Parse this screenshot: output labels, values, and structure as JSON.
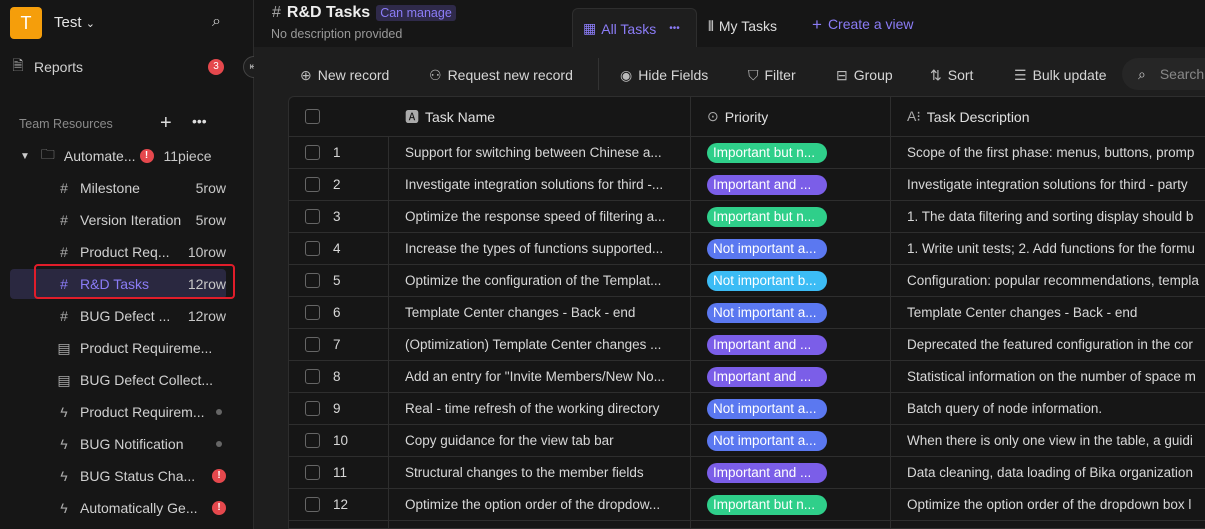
{
  "workspace": {
    "initial": "T",
    "name": "Test"
  },
  "sidebar": {
    "reports": {
      "label": "Reports",
      "badge": "3"
    },
    "section": "Team Resources",
    "folder": {
      "label": "Automate...",
      "count": "11piece"
    },
    "items": [
      {
        "icon": "table-icon",
        "label": "Milestone",
        "count": "5row"
      },
      {
        "icon": "table-icon",
        "label": "Version Iteration",
        "count": "5row"
      },
      {
        "icon": "table-icon",
        "label": "Product Req...",
        "count": "10row"
      },
      {
        "icon": "table-icon",
        "label": "R&D Tasks",
        "count": "12row",
        "active": true
      },
      {
        "icon": "table-icon",
        "label": "BUG Defect ...",
        "count": "12row"
      },
      {
        "icon": "form-icon",
        "label": "Product Requireme..."
      },
      {
        "icon": "form-icon",
        "label": "BUG Defect Collect..."
      },
      {
        "icon": "automation-icon",
        "label": "Product Requirem...",
        "status": "dot"
      },
      {
        "icon": "automation-icon",
        "label": "BUG Notification",
        "status": "dot"
      },
      {
        "icon": "automation-icon",
        "label": "BUG Status Cha...",
        "status": "warn"
      },
      {
        "icon": "automation-icon",
        "label": "Automatically Ge...",
        "status": "warn"
      }
    ]
  },
  "header": {
    "title": "R&D Tasks",
    "permission": "Can manage",
    "description": "No description provided",
    "views": [
      {
        "label": "All Tasks",
        "active": true
      },
      {
        "label": "My Tasks"
      }
    ],
    "create_view": "Create a view"
  },
  "toolbar": {
    "new_record": "New record",
    "request": "Request new record",
    "hide": "Hide Fields",
    "filter": "Filter",
    "group": "Group",
    "sort": "Sort",
    "bulk": "Bulk update",
    "search_placeholder": "Search"
  },
  "table": {
    "columns": [
      "Task Name",
      "Priority",
      "Task Description"
    ],
    "priority_colors": {
      "Important but n...": "#2fcf8a",
      "Important and ...": "#7b5ee8",
      "Not important a...": "#5b78f0",
      "Not important b...": "#3cbcf5"
    },
    "rows": [
      {
        "n": "1",
        "name": "Support for switching between Chinese a...",
        "priority": "Important but n...",
        "desc": "Scope of the first phase: menus, buttons, promp"
      },
      {
        "n": "2",
        "name": "Investigate integration solutions for third -...",
        "priority": "Important and ...",
        "desc": "Investigate integration solutions for third - party"
      },
      {
        "n": "3",
        "name": "Optimize the response speed of filtering a...",
        "priority": "Important but n...",
        "desc": "1. The data filtering and sorting display should b"
      },
      {
        "n": "4",
        "name": "Increase the types of functions supported...",
        "priority": "Not important a...",
        "desc": "1. Write unit tests; 2. Add functions for the formu"
      },
      {
        "n": "5",
        "name": "Optimize the configuration of the Templat...",
        "priority": "Not important b...",
        "desc": "Configuration: popular recommendations, templa"
      },
      {
        "n": "6",
        "name": "Template Center changes - Back - end",
        "priority": "Not important a...",
        "desc": "Template Center changes - Back - end"
      },
      {
        "n": "7",
        "name": "(Optimization) Template Center changes ...",
        "priority": "Important and ...",
        "desc": "Deprecated the featured configuration in the cor"
      },
      {
        "n": "8",
        "name": "Add an entry for \"Invite Members/New No...",
        "priority": "Important and ...",
        "desc": "Statistical information on the number of space m"
      },
      {
        "n": "9",
        "name": "Real - time refresh of the working directory",
        "priority": "Not important a...",
        "desc": "Batch query of node information."
      },
      {
        "n": "10",
        "name": "Copy guidance for the view tab bar",
        "priority": "Not important a...",
        "desc": "When there is only one view in the table, a guidi"
      },
      {
        "n": "11",
        "name": "Structural changes to the member fields",
        "priority": "Important and ...",
        "desc": "Data cleaning, data loading of Bika organization"
      },
      {
        "n": "12",
        "name": "Optimize the option order of the dropdow...",
        "priority": "Important but n...",
        "desc": "Optimize the option order of the dropdown box l"
      }
    ]
  }
}
